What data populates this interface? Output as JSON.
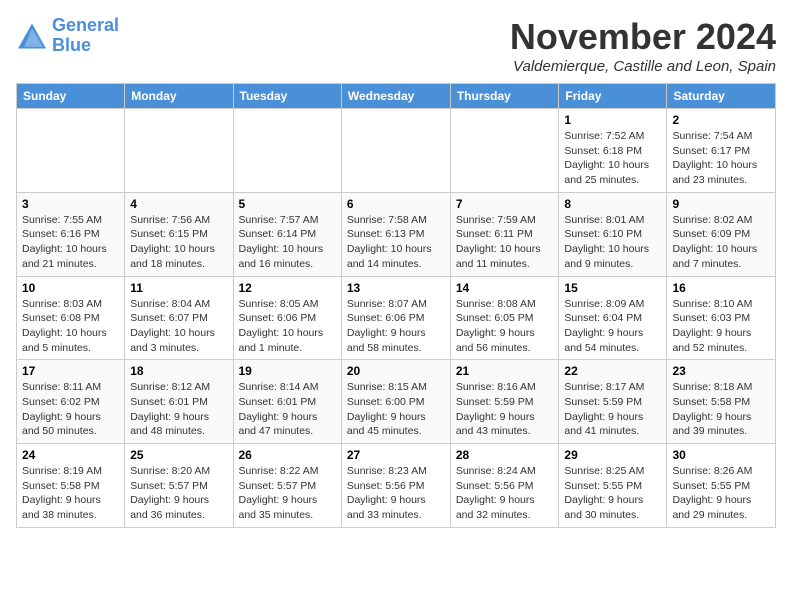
{
  "header": {
    "logo_line1": "General",
    "logo_line2": "Blue",
    "month_title": "November 2024",
    "location": "Valdemierque, Castille and Leon, Spain"
  },
  "weekdays": [
    "Sunday",
    "Monday",
    "Tuesday",
    "Wednesday",
    "Thursday",
    "Friday",
    "Saturday"
  ],
  "weeks": [
    [
      {
        "day": "",
        "info": ""
      },
      {
        "day": "",
        "info": ""
      },
      {
        "day": "",
        "info": ""
      },
      {
        "day": "",
        "info": ""
      },
      {
        "day": "",
        "info": ""
      },
      {
        "day": "1",
        "info": "Sunrise: 7:52 AM\nSunset: 6:18 PM\nDaylight: 10 hours and 25 minutes."
      },
      {
        "day": "2",
        "info": "Sunrise: 7:54 AM\nSunset: 6:17 PM\nDaylight: 10 hours and 23 minutes."
      }
    ],
    [
      {
        "day": "3",
        "info": "Sunrise: 7:55 AM\nSunset: 6:16 PM\nDaylight: 10 hours and 21 minutes."
      },
      {
        "day": "4",
        "info": "Sunrise: 7:56 AM\nSunset: 6:15 PM\nDaylight: 10 hours and 18 minutes."
      },
      {
        "day": "5",
        "info": "Sunrise: 7:57 AM\nSunset: 6:14 PM\nDaylight: 10 hours and 16 minutes."
      },
      {
        "day": "6",
        "info": "Sunrise: 7:58 AM\nSunset: 6:13 PM\nDaylight: 10 hours and 14 minutes."
      },
      {
        "day": "7",
        "info": "Sunrise: 7:59 AM\nSunset: 6:11 PM\nDaylight: 10 hours and 11 minutes."
      },
      {
        "day": "8",
        "info": "Sunrise: 8:01 AM\nSunset: 6:10 PM\nDaylight: 10 hours and 9 minutes."
      },
      {
        "day": "9",
        "info": "Sunrise: 8:02 AM\nSunset: 6:09 PM\nDaylight: 10 hours and 7 minutes."
      }
    ],
    [
      {
        "day": "10",
        "info": "Sunrise: 8:03 AM\nSunset: 6:08 PM\nDaylight: 10 hours and 5 minutes."
      },
      {
        "day": "11",
        "info": "Sunrise: 8:04 AM\nSunset: 6:07 PM\nDaylight: 10 hours and 3 minutes."
      },
      {
        "day": "12",
        "info": "Sunrise: 8:05 AM\nSunset: 6:06 PM\nDaylight: 10 hours and 1 minute."
      },
      {
        "day": "13",
        "info": "Sunrise: 8:07 AM\nSunset: 6:06 PM\nDaylight: 9 hours and 58 minutes."
      },
      {
        "day": "14",
        "info": "Sunrise: 8:08 AM\nSunset: 6:05 PM\nDaylight: 9 hours and 56 minutes."
      },
      {
        "day": "15",
        "info": "Sunrise: 8:09 AM\nSunset: 6:04 PM\nDaylight: 9 hours and 54 minutes."
      },
      {
        "day": "16",
        "info": "Sunrise: 8:10 AM\nSunset: 6:03 PM\nDaylight: 9 hours and 52 minutes."
      }
    ],
    [
      {
        "day": "17",
        "info": "Sunrise: 8:11 AM\nSunset: 6:02 PM\nDaylight: 9 hours and 50 minutes."
      },
      {
        "day": "18",
        "info": "Sunrise: 8:12 AM\nSunset: 6:01 PM\nDaylight: 9 hours and 48 minutes."
      },
      {
        "day": "19",
        "info": "Sunrise: 8:14 AM\nSunset: 6:01 PM\nDaylight: 9 hours and 47 minutes."
      },
      {
        "day": "20",
        "info": "Sunrise: 8:15 AM\nSunset: 6:00 PM\nDaylight: 9 hours and 45 minutes."
      },
      {
        "day": "21",
        "info": "Sunrise: 8:16 AM\nSunset: 5:59 PM\nDaylight: 9 hours and 43 minutes."
      },
      {
        "day": "22",
        "info": "Sunrise: 8:17 AM\nSunset: 5:59 PM\nDaylight: 9 hours and 41 minutes."
      },
      {
        "day": "23",
        "info": "Sunrise: 8:18 AM\nSunset: 5:58 PM\nDaylight: 9 hours and 39 minutes."
      }
    ],
    [
      {
        "day": "24",
        "info": "Sunrise: 8:19 AM\nSunset: 5:58 PM\nDaylight: 9 hours and 38 minutes."
      },
      {
        "day": "25",
        "info": "Sunrise: 8:20 AM\nSunset: 5:57 PM\nDaylight: 9 hours and 36 minutes."
      },
      {
        "day": "26",
        "info": "Sunrise: 8:22 AM\nSunset: 5:57 PM\nDaylight: 9 hours and 35 minutes."
      },
      {
        "day": "27",
        "info": "Sunrise: 8:23 AM\nSunset: 5:56 PM\nDaylight: 9 hours and 33 minutes."
      },
      {
        "day": "28",
        "info": "Sunrise: 8:24 AM\nSunset: 5:56 PM\nDaylight: 9 hours and 32 minutes."
      },
      {
        "day": "29",
        "info": "Sunrise: 8:25 AM\nSunset: 5:55 PM\nDaylight: 9 hours and 30 minutes."
      },
      {
        "day": "30",
        "info": "Sunrise: 8:26 AM\nSunset: 5:55 PM\nDaylight: 9 hours and 29 minutes."
      }
    ]
  ]
}
